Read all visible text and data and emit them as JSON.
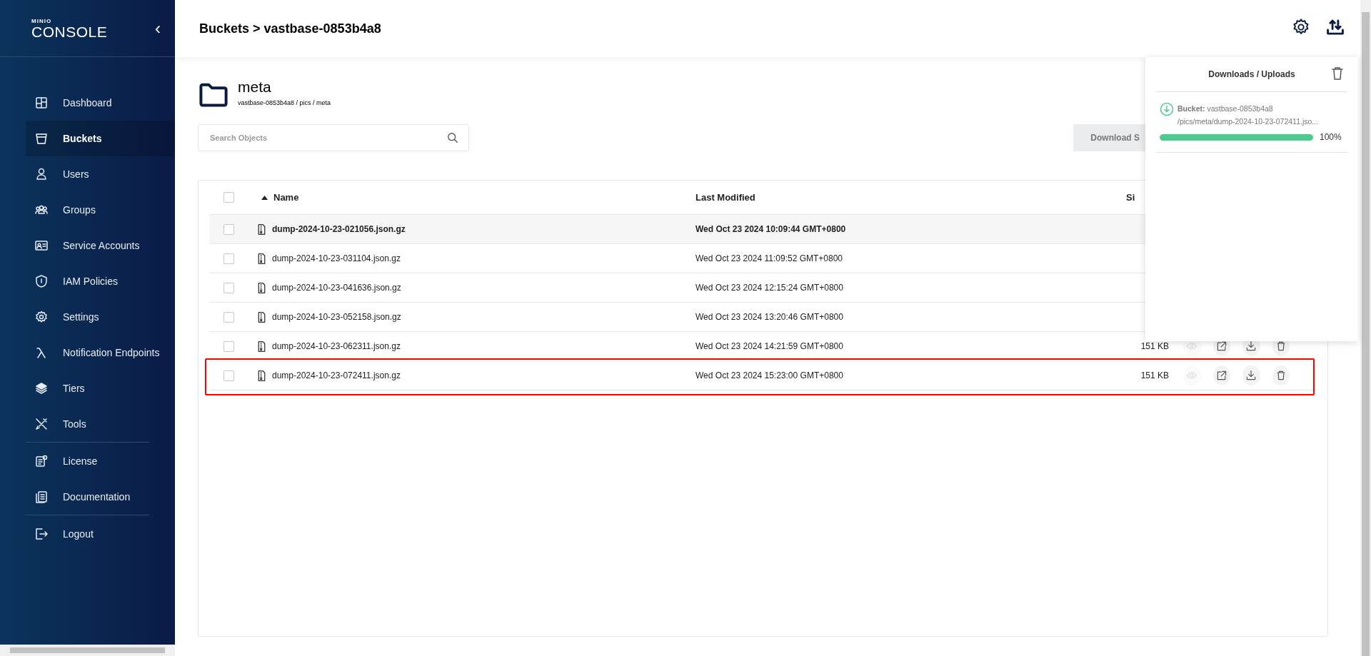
{
  "sidebar": {
    "logo_top": "MINIO",
    "logo_bottom": "CONSOLE",
    "collapse": "‹",
    "items": [
      {
        "label": "Dashboard",
        "kind": "dashboard",
        "selected": false,
        "divider_after": false
      },
      {
        "label": "Buckets",
        "kind": "bucket",
        "selected": true,
        "divider_after": false
      },
      {
        "label": "Users",
        "kind": "user",
        "selected": false,
        "divider_after": false
      },
      {
        "label": "Groups",
        "kind": "group",
        "selected": false,
        "divider_after": false
      },
      {
        "label": "Service Accounts",
        "kind": "card",
        "selected": false,
        "divider_after": false
      },
      {
        "label": "IAM Policies",
        "kind": "shield",
        "selected": false,
        "divider_after": false
      },
      {
        "label": "Settings",
        "kind": "gear",
        "selected": false,
        "divider_after": false
      },
      {
        "label": "Notification Endpoints",
        "kind": "lambda",
        "selected": false,
        "divider_after": false
      },
      {
        "label": "Tiers",
        "kind": "layers",
        "selected": false,
        "divider_after": false
      },
      {
        "label": "Tools",
        "kind": "tools",
        "selected": false,
        "divider_after": true
      },
      {
        "label": "License",
        "kind": "license",
        "selected": false,
        "divider_after": false
      },
      {
        "label": "Documentation",
        "kind": "docs",
        "selected": false,
        "divider_after": true
      },
      {
        "label": "Logout",
        "kind": "logout",
        "selected": false,
        "divider_after": false
      }
    ]
  },
  "header": {
    "breadcrumb": "Buckets > vastbase-0853b4a8"
  },
  "folder": {
    "name": "meta",
    "path": "vastbase-0853b4a8 / pics / meta"
  },
  "search": {
    "placeholder": "Search Objects"
  },
  "download_button": "Download S",
  "table": {
    "header_checked": false,
    "columns": {
      "name": "Name",
      "modified": "Last Modified",
      "size": "Si"
    },
    "rows": [
      {
        "name": "dump-2024-10-23-021056.json.gz",
        "modified": "Wed Oct 23 2024 10:09:44 GMT+0800",
        "checked": false,
        "hovered": true,
        "annotated": false
      },
      {
        "name": "dump-2024-10-23-031104.json.gz",
        "modified": "Wed Oct 23 2024 11:09:52 GMT+0800",
        "checked": false,
        "hovered": false,
        "annotated": false
      },
      {
        "name": "dump-2024-10-23-041636.json.gz",
        "modified": "Wed Oct 23 2024 12:15:24 GMT+0800",
        "checked": false,
        "hovered": false,
        "annotated": false
      },
      {
        "name": "dump-2024-10-23-052158.json.gz",
        "modified": "Wed Oct 23 2024 13:20:46 GMT+0800",
        "checked": false,
        "hovered": false,
        "annotated": false
      },
      {
        "name": "dump-2024-10-23-062311.json.gz",
        "modified": "Wed Oct 23 2024 14:21:59 GMT+0800",
        "size": "151 KB",
        "checked": false,
        "hovered": false,
        "annotated": false,
        "actions": [
          {
            "kind": "preview",
            "disabled": true
          },
          {
            "kind": "share",
            "disabled": false
          },
          {
            "kind": "download",
            "disabled": false
          },
          {
            "kind": "delete",
            "disabled": false
          }
        ]
      },
      {
        "name": "dump-2024-10-23-072411.json.gz",
        "modified": "Wed Oct 23 2024 15:23:00 GMT+0800",
        "size": "151 KB",
        "checked": false,
        "hovered": false,
        "annotated": true,
        "actions": [
          {
            "kind": "preview",
            "disabled": true
          },
          {
            "kind": "share",
            "disabled": false
          },
          {
            "kind": "download",
            "disabled": false
          },
          {
            "kind": "delete",
            "disabled": false
          }
        ]
      }
    ]
  },
  "transfers": {
    "title": "Downloads / Uploads",
    "items": [
      {
        "kind": "download",
        "bucket_label": "Bucket:",
        "bucket": "vastbase-0853b4a8",
        "path": "/pics/meta/dump-2024-10-23-072411.jso...",
        "level": 1,
        "percent": "100%"
      }
    ]
  }
}
